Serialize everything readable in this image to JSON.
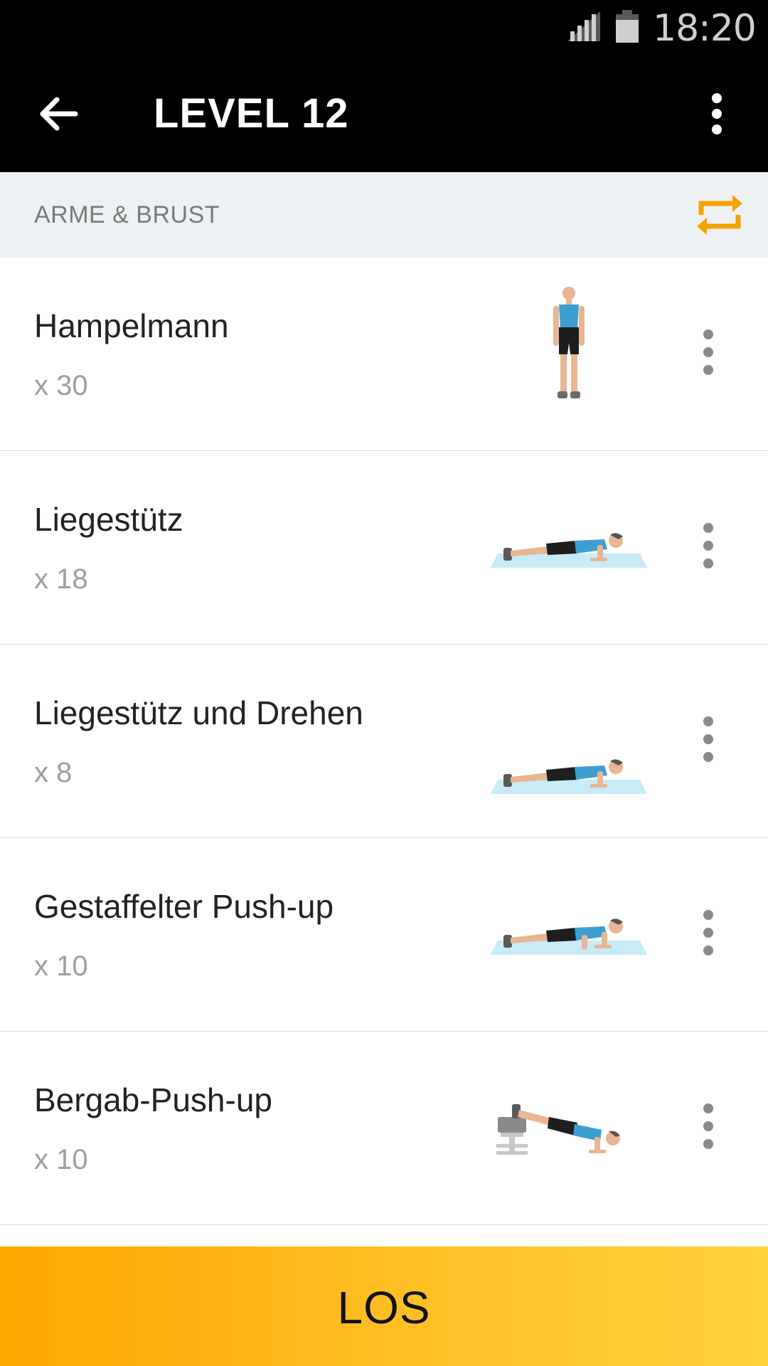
{
  "status_bar": {
    "time": "18:20",
    "signal_icon": "signal-icon",
    "battery_icon": "battery-icon"
  },
  "app_bar": {
    "title": "LEVEL 12",
    "back_icon": "arrow-back-icon",
    "menu_icon": "more-vert-icon"
  },
  "section": {
    "title": "ARME & BRUST",
    "action_icon": "repeat-icon",
    "accent_color": "#f5a100"
  },
  "exercises": [
    {
      "name": "Hampelmann",
      "reps": "x 30",
      "illustration": "jumping-jack-figure"
    },
    {
      "name": "Liegestütz",
      "reps": "x 18",
      "illustration": "push-up-figure"
    },
    {
      "name": "Liegestütz und Drehen",
      "reps": "x 8",
      "illustration": "push-up-rotation-figure"
    },
    {
      "name": "Gestaffelter Push-up",
      "reps": "x 10",
      "illustration": "staggered-push-up-figure"
    },
    {
      "name": "Bergab-Push-up",
      "reps": "x 10",
      "illustration": "decline-push-up-figure"
    }
  ],
  "start_button": {
    "label": "LOS",
    "colors": [
      "#ffa800",
      "#ffd23a"
    ]
  }
}
